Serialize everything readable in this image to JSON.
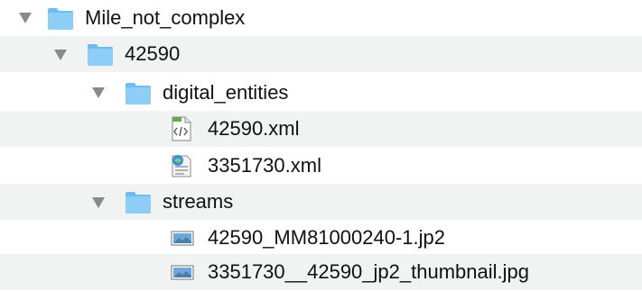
{
  "tree": [
    {
      "label": "Mile_not_complex",
      "type": "folder",
      "expanded": true,
      "icon": "folder-icon"
    },
    {
      "label": "42590",
      "type": "folder",
      "expanded": true,
      "icon": "folder-icon"
    },
    {
      "label": "digital_entities",
      "type": "folder",
      "expanded": true,
      "icon": "folder-icon"
    },
    {
      "label": "42590.xml",
      "type": "file",
      "icon": "xml-file-icon"
    },
    {
      "label": "3351730.xml",
      "type": "file",
      "icon": "xml-document-icon"
    },
    {
      "label": "streams",
      "type": "folder",
      "expanded": true,
      "icon": "folder-icon"
    },
    {
      "label": "42590_MM81000240-1.jp2",
      "type": "file",
      "icon": "image-file-icon"
    },
    {
      "label": "3351730__42590_jp2_thumbnail.jpg",
      "type": "file",
      "icon": "image-file-icon"
    }
  ],
  "colors": {
    "folder": "#8dcdf6",
    "folder_tab": "#6fbdf0",
    "stripe": "#f1f2f2",
    "disclosure": "#8a8a8a"
  }
}
